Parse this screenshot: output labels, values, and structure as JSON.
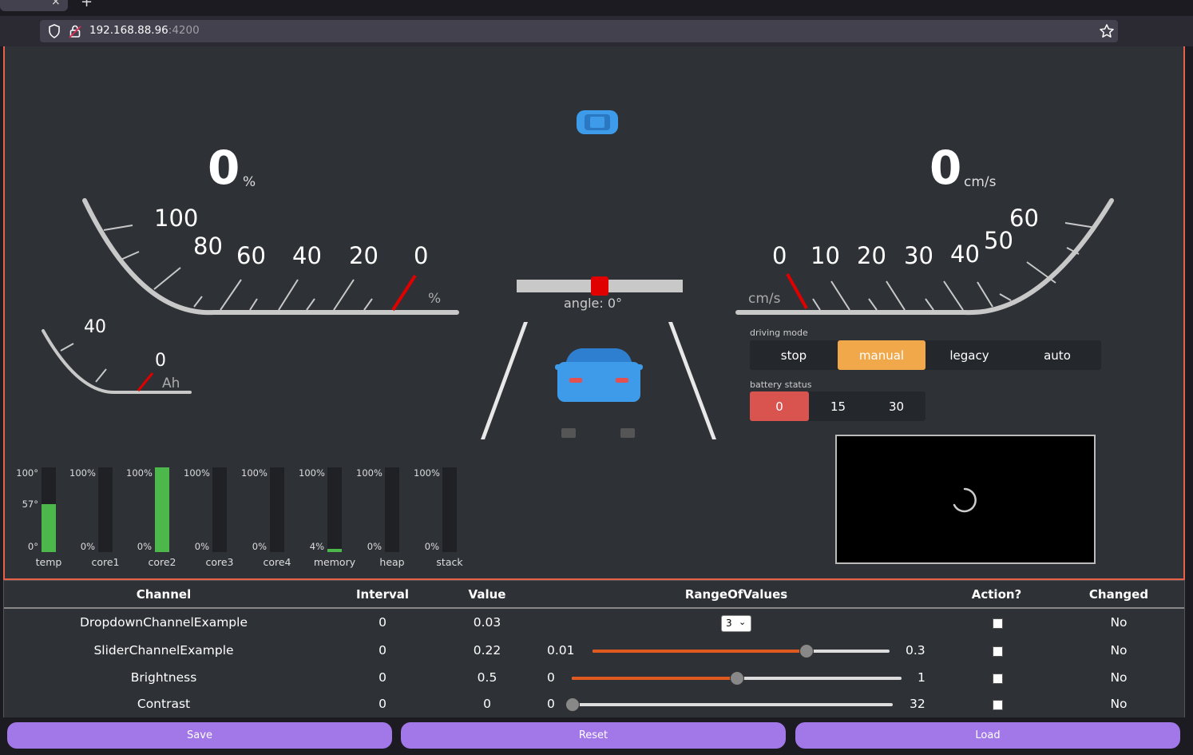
{
  "browser": {
    "tab_close": "×",
    "new_tab": "+",
    "url_host": "192.168.88.96",
    "url_port": ":4200"
  },
  "battery_gauge": {
    "value": "0",
    "unit": "%",
    "ticks": [
      "100",
      "80",
      "60",
      "40",
      "20",
      "0"
    ],
    "axis_unit": "%"
  },
  "speed_gauge": {
    "value": "0",
    "unit": "cm/s",
    "ticks": [
      "0",
      "10",
      "20",
      "30",
      "40",
      "50",
      "60"
    ],
    "axis_unit": "cm/s"
  },
  "ah_gauge": {
    "ticks": [
      "40",
      "0"
    ],
    "unit": "Ah"
  },
  "steering": {
    "angle_label": "angle: 0°",
    "angle": 0
  },
  "driving_mode": {
    "title": "driving mode",
    "options": [
      "stop",
      "manual",
      "legacy",
      "auto"
    ],
    "selected": "manual"
  },
  "battery_status": {
    "title": "battery status",
    "options": [
      "0",
      "15",
      "30"
    ],
    "selected": "0"
  },
  "bars": [
    {
      "name": "temp",
      "top": "100°",
      "mid": "57°",
      "bottom": "0°",
      "level": 0.57
    },
    {
      "name": "core1",
      "top": "100%",
      "bottom": "0%",
      "level": 0
    },
    {
      "name": "core2",
      "top": "100%",
      "bottom": "0%",
      "level": 1.0
    },
    {
      "name": "core3",
      "top": "100%",
      "bottom": "0%",
      "level": 0
    },
    {
      "name": "core4",
      "top": "100%",
      "bottom": "0%",
      "level": 0
    },
    {
      "name": "memory",
      "top": "100%",
      "bottom": "4%",
      "level": 0.04
    },
    {
      "name": "heap",
      "top": "100%",
      "bottom": "0%",
      "level": 0
    },
    {
      "name": "stack",
      "top": "100%",
      "bottom": "0%",
      "level": 0
    }
  ],
  "table": {
    "headers": [
      "Channel",
      "Interval",
      "Value",
      "RangeOfValues",
      "Action?",
      "Changed"
    ],
    "rows": [
      {
        "channel": "DropdownChannelExample",
        "interval": "0",
        "value": "0.03",
        "select": "3",
        "changed": "No"
      },
      {
        "channel": "SliderChannelExample",
        "interval": "0",
        "value": "0.22",
        "min": "0.01",
        "max": "0.3",
        "level": 0.72,
        "changed": "No"
      },
      {
        "channel": "Brightness",
        "interval": "0",
        "value": "0.5",
        "min": "0",
        "max": "1",
        "level": 0.5,
        "changed": "No"
      },
      {
        "channel": "Contrast",
        "interval": "0",
        "value": "0",
        "min": "0",
        "max": "32",
        "level": 0,
        "changed": "No"
      }
    ]
  },
  "buttons": {
    "save": "Save",
    "reset": "Reset",
    "load": "Load"
  },
  "colors": {
    "accent_frame": "#e8604a",
    "button": "#a277e8",
    "mode_active": "#f0a84a",
    "battery_active": "#d9534f",
    "bar_fill": "#4cb84c",
    "car": "#3d9be9",
    "slider_fill": "#e05a1f"
  }
}
